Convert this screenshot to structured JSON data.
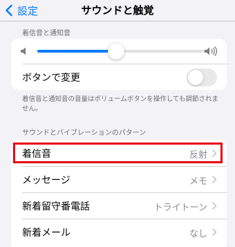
{
  "nav": {
    "back_label": "設定",
    "title": "サウンドと触覚"
  },
  "ringer_section": {
    "header": "着信音と通知音",
    "volume_level": 0.46,
    "change_with_buttons_label": "ボタンで変更",
    "change_with_buttons_on": false,
    "footer": "着信音と通知音の音量はボリュームボタンを操作しても調節されません。"
  },
  "patterns_section": {
    "header": "サウンドとバイブレーションのパターン",
    "rows": [
      {
        "label": "着信音",
        "value": "反射"
      },
      {
        "label": "メッセージ",
        "value": "メモ"
      },
      {
        "label": "新着留守番電話",
        "value": "トライトーン"
      },
      {
        "label": "新着メール",
        "value": "なし"
      }
    ]
  },
  "colors": {
    "accent": "#007aff",
    "highlight": "#e60012",
    "background": "#f2f2f7"
  }
}
